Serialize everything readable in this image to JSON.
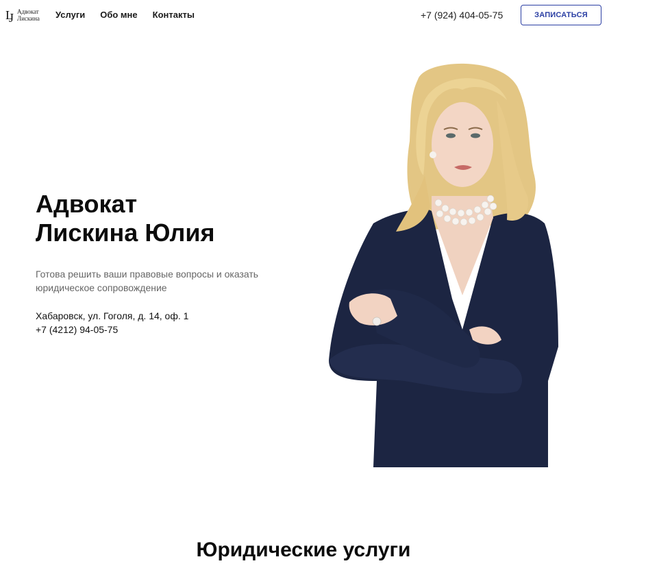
{
  "header": {
    "logo": {
      "monogram": "LJ",
      "line1": "Адвокат",
      "line2": "Лискина"
    },
    "nav": [
      {
        "label": "Услуги"
      },
      {
        "label": "Обо мне"
      },
      {
        "label": "Контакты"
      }
    ],
    "phone": "+7 (924) 404-05-75",
    "cta_label": "ЗАПИСАТЬСЯ"
  },
  "hero": {
    "title_line1": "Адвокат",
    "title_line2": "Лискина Юлия",
    "subtitle": "Готова решить ваши правовые вопросы и оказать юридическое сопровождение",
    "address": "Хабаровск, ул. Гоголя, д. 14, оф. 1",
    "phone": "+7 (4212) 94-05-75",
    "portrait_icon": "lawyer-portrait-photo"
  },
  "services": {
    "title": "Юридические услуги"
  },
  "colors": {
    "accent": "#2a3ea3",
    "dress": "#1c2542",
    "hair": "#e8cf8e",
    "text_muted": "#666666"
  }
}
